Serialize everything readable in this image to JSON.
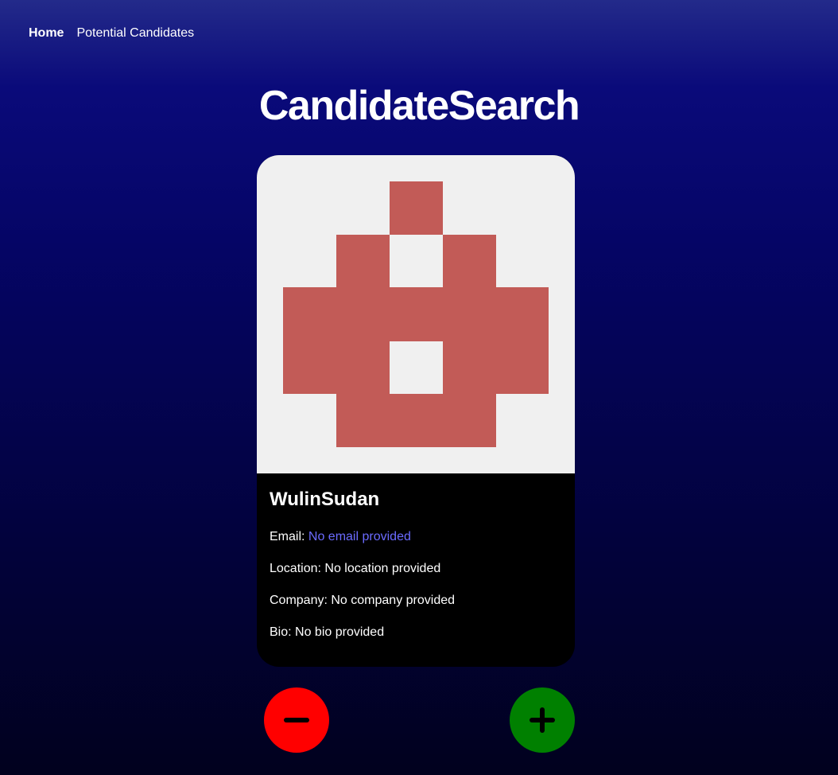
{
  "nav": {
    "home_label": "Home",
    "potential_label": "Potential Candidates"
  },
  "page": {
    "title": "CandidateSearch"
  },
  "candidate": {
    "username": "WulinSudan",
    "email_label": "Email: ",
    "email_value": "No email provided",
    "location_text": "Location: No location provided",
    "company_text": "Company: No company provided",
    "bio_text": "Bio: No bio provided",
    "avatar_icon": "identicon-avatar",
    "avatar_color": "#c25b57",
    "avatar_background": "#f0f0f0"
  },
  "actions": {
    "reject_icon": "minus-icon",
    "accept_icon": "plus-icon",
    "reject_color": "#ff0000",
    "accept_color": "#008000"
  }
}
